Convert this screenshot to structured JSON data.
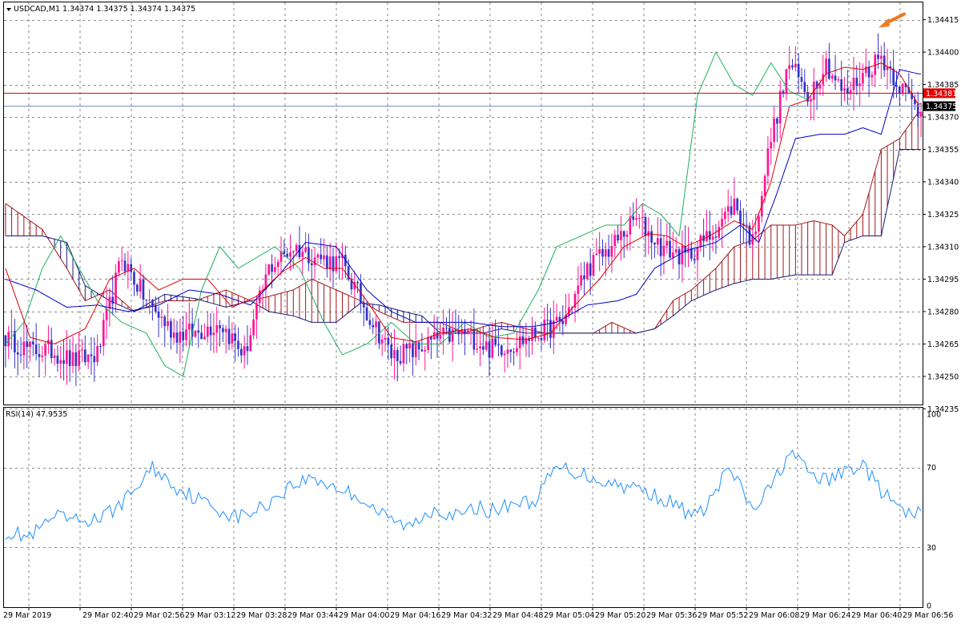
{
  "header": {
    "main_label": "USDCAD,M1  1.34374 1.34375 1.34374 1.34375",
    "rsi_label": "RSI(14) 47.9535"
  },
  "colors": {
    "bull": "#ff1493",
    "bear": "#3333cc",
    "tenkan": "#e00000",
    "kijun": "#0000c8",
    "chikou": "#20b060",
    "cloud_up": "#a0181c",
    "cloud_down": "#1a1a7a",
    "rsi": "#1e90ff",
    "price_line_red": "#e00000",
    "price_line_bid": "#7a94c0",
    "arrow": "#f07820"
  },
  "chart_data": [
    {
      "type": "candlestick",
      "symbol": "USDCAD",
      "timeframe": "M1",
      "ylim": [
        1.34237,
        1.34423
      ],
      "y_ticks": [
        "1.34415",
        "1.34400",
        "1.34385",
        "1.34370",
        "1.34355",
        "1.34340",
        "1.34325",
        "1.34310",
        "1.34295",
        "1.34280",
        "1.34265",
        "1.34250",
        "1.34235"
      ],
      "price_labels": [
        {
          "value": "1.34381",
          "kind": "red"
        },
        {
          "value": "1.34375",
          "kind": "bid"
        }
      ],
      "x_labels": [
        "29 Mar 2019",
        "29 Mar 02:40",
        "29 Mar 02:56",
        "29 Mar 03:12",
        "29 Mar 03:28",
        "29 Mar 03:44",
        "29 Mar 04:00",
        "29 Mar 04:16",
        "29 Mar 04:32",
        "29 Mar 04:48",
        "29 Mar 05:04",
        "29 Mar 05:20",
        "29 Mar 05:36",
        "29 Mar 05:52",
        "29 Mar 06:08",
        "29 Mar 06:24",
        "29 Mar 06:40",
        "29 Mar 06:56"
      ],
      "close_anchors": [
        [
          0,
          1.34268
        ],
        [
          8,
          1.34262
        ],
        [
          15,
          1.34262
        ],
        [
          22,
          1.34257
        ],
        [
          30,
          1.3426
        ],
        [
          38,
          1.34305
        ],
        [
          46,
          1.34285
        ],
        [
          55,
          1.3427
        ],
        [
          62,
          1.3427
        ],
        [
          70,
          1.34275
        ],
        [
          78,
          1.3426
        ],
        [
          86,
          1.343
        ],
        [
          94,
          1.3431
        ],
        [
          102,
          1.34305
        ],
        [
          110,
          1.34302
        ],
        [
          118,
          1.3428
        ],
        [
          126,
          1.3426
        ],
        [
          134,
          1.34262
        ],
        [
          142,
          1.34268
        ],
        [
          150,
          1.3427
        ],
        [
          158,
          1.34263
        ],
        [
          166,
          1.34265
        ],
        [
          174,
          1.3427
        ],
        [
          182,
          1.34275
        ],
        [
          190,
          1.343
        ],
        [
          198,
          1.3431
        ],
        [
          206,
          1.34323
        ],
        [
          214,
          1.3431
        ],
        [
          222,
          1.34305
        ],
        [
          230,
          1.34315
        ],
        [
          238,
          1.3433
        ],
        [
          244,
          1.34312
        ],
        [
          250,
          1.3436
        ],
        [
          256,
          1.34395
        ],
        [
          262,
          1.3438
        ],
        [
          268,
          1.34395
        ],
        [
          274,
          1.3438
        ],
        [
          280,
          1.3439
        ],
        [
          286,
          1.34398
        ],
        [
          292,
          1.34385
        ],
        [
          298,
          1.34373
        ]
      ],
      "tenkan_anchors": [
        [
          0,
          1.343
        ],
        [
          8,
          1.34268
        ],
        [
          16,
          1.34265
        ],
        [
          26,
          1.34272
        ],
        [
          34,
          1.34295
        ],
        [
          42,
          1.343
        ],
        [
          50,
          1.3429
        ],
        [
          58,
          1.34295
        ],
        [
          66,
          1.34295
        ],
        [
          74,
          1.34282
        ],
        [
          82,
          1.34287
        ],
        [
          90,
          1.34298
        ],
        [
          98,
          1.34305
        ],
        [
          104,
          1.343
        ],
        [
          110,
          1.343
        ],
        [
          118,
          1.34285
        ],
        [
          126,
          1.34268
        ],
        [
          134,
          1.34266
        ],
        [
          142,
          1.3427
        ],
        [
          152,
          1.34272
        ],
        [
          160,
          1.34268
        ],
        [
          170,
          1.34267
        ],
        [
          178,
          1.3427
        ],
        [
          186,
          1.34283
        ],
        [
          194,
          1.34295
        ],
        [
          202,
          1.3431
        ],
        [
          210,
          1.34316
        ],
        [
          216,
          1.34315
        ],
        [
          222,
          1.3431
        ],
        [
          230,
          1.34315
        ],
        [
          238,
          1.34322
        ],
        [
          244,
          1.34318
        ],
        [
          250,
          1.3434
        ],
        [
          256,
          1.34375
        ],
        [
          262,
          1.34378
        ],
        [
          268,
          1.3439
        ],
        [
          274,
          1.34393
        ],
        [
          280,
          1.34392
        ],
        [
          286,
          1.34395
        ],
        [
          292,
          1.3439
        ],
        [
          298,
          1.34376
        ]
      ],
      "kijun_anchors": [
        [
          0,
          1.34295
        ],
        [
          10,
          1.3429
        ],
        [
          20,
          1.34282
        ],
        [
          30,
          1.34283
        ],
        [
          40,
          1.3428
        ],
        [
          50,
          1.34283
        ],
        [
          60,
          1.3429
        ],
        [
          70,
          1.34288
        ],
        [
          80,
          1.34283
        ],
        [
          90,
          1.34298
        ],
        [
          98,
          1.34312
        ],
        [
          108,
          1.3431
        ],
        [
          118,
          1.3429
        ],
        [
          126,
          1.3428
        ],
        [
          134,
          1.34275
        ],
        [
          142,
          1.34275
        ],
        [
          152,
          1.34275
        ],
        [
          162,
          1.34273
        ],
        [
          172,
          1.34273
        ],
        [
          180,
          1.34275
        ],
        [
          190,
          1.34283
        ],
        [
          200,
          1.34285
        ],
        [
          206,
          1.34288
        ],
        [
          212,
          1.343
        ],
        [
          222,
          1.34308
        ],
        [
          232,
          1.34312
        ],
        [
          240,
          1.3432
        ],
        [
          246,
          1.34312
        ],
        [
          252,
          1.34335
        ],
        [
          258,
          1.3436
        ],
        [
          266,
          1.34362
        ],
        [
          274,
          1.34362
        ],
        [
          280,
          1.34365
        ],
        [
          286,
          1.34362
        ],
        [
          292,
          1.34392
        ],
        [
          298,
          1.3439
        ]
      ],
      "chikou_anchors": [
        [
          0,
          1.34265
        ],
        [
          6,
          1.34275
        ],
        [
          12,
          1.343
        ],
        [
          18,
          1.34315
        ],
        [
          24,
          1.343
        ],
        [
          30,
          1.34285
        ],
        [
          38,
          1.34275
        ],
        [
          46,
          1.3427
        ],
        [
          52,
          1.34255
        ],
        [
          58,
          1.3425
        ],
        [
          64,
          1.3429
        ],
        [
          70,
          1.3431
        ],
        [
          76,
          1.343
        ],
        [
          82,
          1.34305
        ],
        [
          88,
          1.3431
        ],
        [
          96,
          1.343
        ],
        [
          104,
          1.34275
        ],
        [
          110,
          1.3426
        ],
        [
          118,
          1.34265
        ],
        [
          126,
          1.34275
        ],
        [
          134,
          1.34265
        ],
        [
          142,
          1.34265
        ],
        [
          150,
          1.34275
        ],
        [
          158,
          1.34268
        ],
        [
          166,
          1.3427
        ],
        [
          174,
          1.3429
        ],
        [
          180,
          1.3431
        ],
        [
          188,
          1.34315
        ],
        [
          196,
          1.3432
        ],
        [
          202,
          1.3432
        ],
        [
          208,
          1.3433
        ],
        [
          214,
          1.34325
        ],
        [
          220,
          1.34315
        ],
        [
          226,
          1.3438
        ],
        [
          232,
          1.344
        ],
        [
          238,
          1.34385
        ],
        [
          244,
          1.3438
        ],
        [
          250,
          1.34395
        ],
        [
          256,
          1.34382
        ],
        [
          262,
          1.34378
        ]
      ],
      "span_a_anchors": [
        [
          0,
          1.3433
        ],
        [
          12,
          1.34318
        ],
        [
          20,
          1.343
        ],
        [
          26,
          1.34285
        ],
        [
          34,
          1.3429
        ],
        [
          42,
          1.3428
        ],
        [
          52,
          1.34285
        ],
        [
          62,
          1.34285
        ],
        [
          72,
          1.3429
        ],
        [
          80,
          1.34285
        ],
        [
          86,
          1.34287
        ],
        [
          94,
          1.3429
        ],
        [
          100,
          1.34295
        ],
        [
          108,
          1.3429
        ],
        [
          116,
          1.34285
        ],
        [
          122,
          1.3428
        ],
        [
          130,
          1.34275
        ],
        [
          136,
          1.34275
        ],
        [
          142,
          1.34275
        ],
        [
          150,
          1.3427
        ],
        [
          156,
          1.34273
        ],
        [
          162,
          1.34275
        ],
        [
          170,
          1.34272
        ],
        [
          176,
          1.3427
        ],
        [
          184,
          1.3427
        ],
        [
          192,
          1.3427
        ],
        [
          198,
          1.34275
        ],
        [
          206,
          1.3427
        ],
        [
          212,
          1.34272
        ],
        [
          218,
          1.34285
        ],
        [
          224,
          1.3429
        ],
        [
          232,
          1.343
        ],
        [
          238,
          1.3431
        ],
        [
          244,
          1.34313
        ],
        [
          250,
          1.3432
        ],
        [
          258,
          1.3432
        ],
        [
          264,
          1.34322
        ],
        [
          270,
          1.3432
        ],
        [
          274,
          1.34315
        ],
        [
          280,
          1.34325
        ],
        [
          286,
          1.34355
        ],
        [
          292,
          1.3436
        ],
        [
          298,
          1.34372
        ]
      ],
      "span_b_anchors": [
        [
          0,
          1.34315
        ],
        [
          12,
          1.34315
        ],
        [
          20,
          1.34312
        ],
        [
          26,
          1.34292
        ],
        [
          34,
          1.34285
        ],
        [
          42,
          1.3428
        ],
        [
          52,
          1.34288
        ],
        [
          62,
          1.34286
        ],
        [
          72,
          1.34282
        ],
        [
          80,
          1.34285
        ],
        [
          86,
          1.3428
        ],
        [
          94,
          1.34278
        ],
        [
          100,
          1.34275
        ],
        [
          108,
          1.34275
        ],
        [
          116,
          1.34284
        ],
        [
          122,
          1.34283
        ],
        [
          130,
          1.3428
        ],
        [
          136,
          1.34278
        ],
        [
          142,
          1.3427
        ],
        [
          150,
          1.3427
        ],
        [
          156,
          1.3427
        ],
        [
          162,
          1.34272
        ],
        [
          170,
          1.3427
        ],
        [
          176,
          1.3427
        ],
        [
          184,
          1.3427
        ],
        [
          192,
          1.3427
        ],
        [
          198,
          1.3427
        ],
        [
          206,
          1.3427
        ],
        [
          212,
          1.34272
        ],
        [
          218,
          1.34278
        ],
        [
          224,
          1.34285
        ],
        [
          232,
          1.3429
        ],
        [
          238,
          1.34293
        ],
        [
          244,
          1.34295
        ],
        [
          250,
          1.34295
        ],
        [
          258,
          1.34297
        ],
        [
          264,
          1.34297
        ],
        [
          270,
          1.34297
        ],
        [
          274,
          1.34312
        ],
        [
          280,
          1.34315
        ],
        [
          286,
          1.34315
        ],
        [
          292,
          1.34355
        ],
        [
          298,
          1.34355
        ]
      ],
      "annotations": [
        {
          "type": "arrow",
          "target_value": 1.34415,
          "direction": "down-left"
        }
      ],
      "grid": true
    },
    {
      "type": "line",
      "name": "RSI(14)",
      "current_value": 47.9535,
      "ylim": [
        0,
        100
      ],
      "y_ticks": [
        "100",
        "70",
        "30",
        "0"
      ],
      "rsi_anchors": [
        [
          0,
          38
        ],
        [
          8,
          35
        ],
        [
          16,
          45
        ],
        [
          24,
          43
        ],
        [
          32,
          45
        ],
        [
          40,
          55
        ],
        [
          48,
          70
        ],
        [
          56,
          60
        ],
        [
          62,
          55
        ],
        [
          68,
          50
        ],
        [
          76,
          45
        ],
        [
          84,
          50
        ],
        [
          92,
          60
        ],
        [
          100,
          65
        ],
        [
          108,
          60
        ],
        [
          116,
          55
        ],
        [
          124,
          45
        ],
        [
          132,
          40
        ],
        [
          140,
          50
        ],
        [
          148,
          45
        ],
        [
          154,
          50
        ],
        [
          160,
          48
        ],
        [
          166,
          53
        ],
        [
          172,
          52
        ],
        [
          180,
          70
        ],
        [
          186,
          68
        ],
        [
          192,
          65
        ],
        [
          198,
          62
        ],
        [
          206,
          60
        ],
        [
          214,
          55
        ],
        [
          220,
          50
        ],
        [
          226,
          45
        ],
        [
          232,
          58
        ],
        [
          236,
          70
        ],
        [
          240,
          60
        ],
        [
          244,
          48
        ],
        [
          250,
          60
        ],
        [
          256,
          78
        ],
        [
          262,
          68
        ],
        [
          268,
          63
        ],
        [
          274,
          68
        ],
        [
          280,
          72
        ],
        [
          284,
          62
        ],
        [
          288,
          55
        ],
        [
          292,
          50
        ],
        [
          294,
          45
        ],
        [
          298,
          48
        ]
      ]
    }
  ]
}
